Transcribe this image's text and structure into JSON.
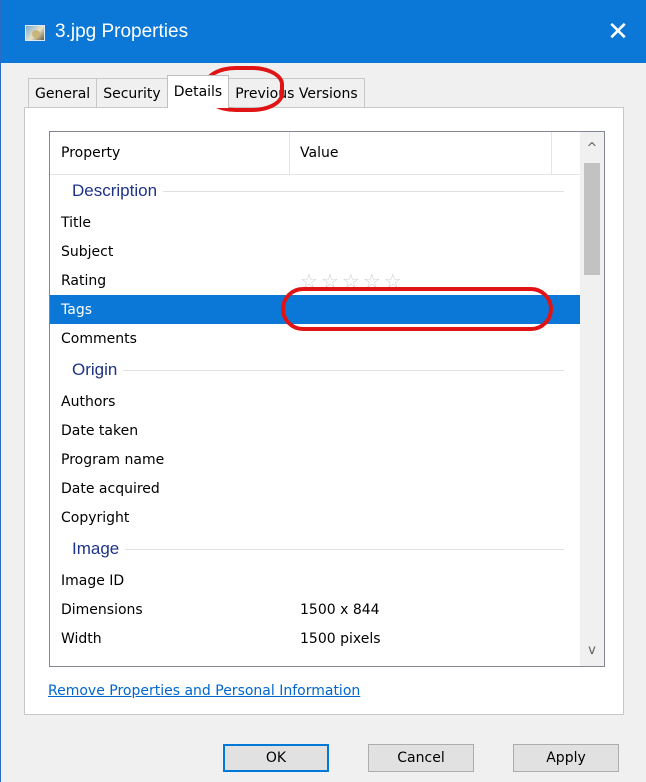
{
  "window": {
    "title": "3.jpg Properties",
    "title_icon": "jpeg-file-icon",
    "close_glyph": "✕",
    "accent": "#0b78d7"
  },
  "tabs": [
    {
      "label": "General",
      "active": false
    },
    {
      "label": "Security",
      "active": false
    },
    {
      "label": "Details",
      "active": true
    },
    {
      "label": "Previous Versions",
      "active": false
    }
  ],
  "list": {
    "header": {
      "property": "Property",
      "value": "Value"
    },
    "groups": {
      "description": {
        "label": "Description",
        "rows": [
          {
            "property": "Title",
            "value": ""
          },
          {
            "property": "Subject",
            "value": ""
          },
          {
            "property": "Rating",
            "value": ""
          },
          {
            "property": "Tags",
            "value": ""
          },
          {
            "property": "Comments",
            "value": ""
          }
        ]
      },
      "origin": {
        "label": "Origin",
        "rows": [
          {
            "property": "Authors",
            "value": ""
          },
          {
            "property": "Date taken",
            "value": ""
          },
          {
            "property": "Program name",
            "value": ""
          },
          {
            "property": "Date acquired",
            "value": ""
          },
          {
            "property": "Copyright",
            "value": ""
          }
        ]
      },
      "image": {
        "label": "Image",
        "rows": [
          {
            "property": "Image ID",
            "value": ""
          },
          {
            "property": "Dimensions",
            "value": "1500 x 844"
          },
          {
            "property": "Width",
            "value": "1500 pixels"
          }
        ]
      }
    },
    "rating_stars": 0,
    "rating_max": 5,
    "selected_row": "Tags",
    "scroll": {
      "up_glyph": "^",
      "down_glyph": "v"
    }
  },
  "links": {
    "remove_properties": "Remove Properties and Personal Information"
  },
  "buttons": {
    "ok": "OK",
    "cancel": "Cancel",
    "apply": "Apply"
  }
}
